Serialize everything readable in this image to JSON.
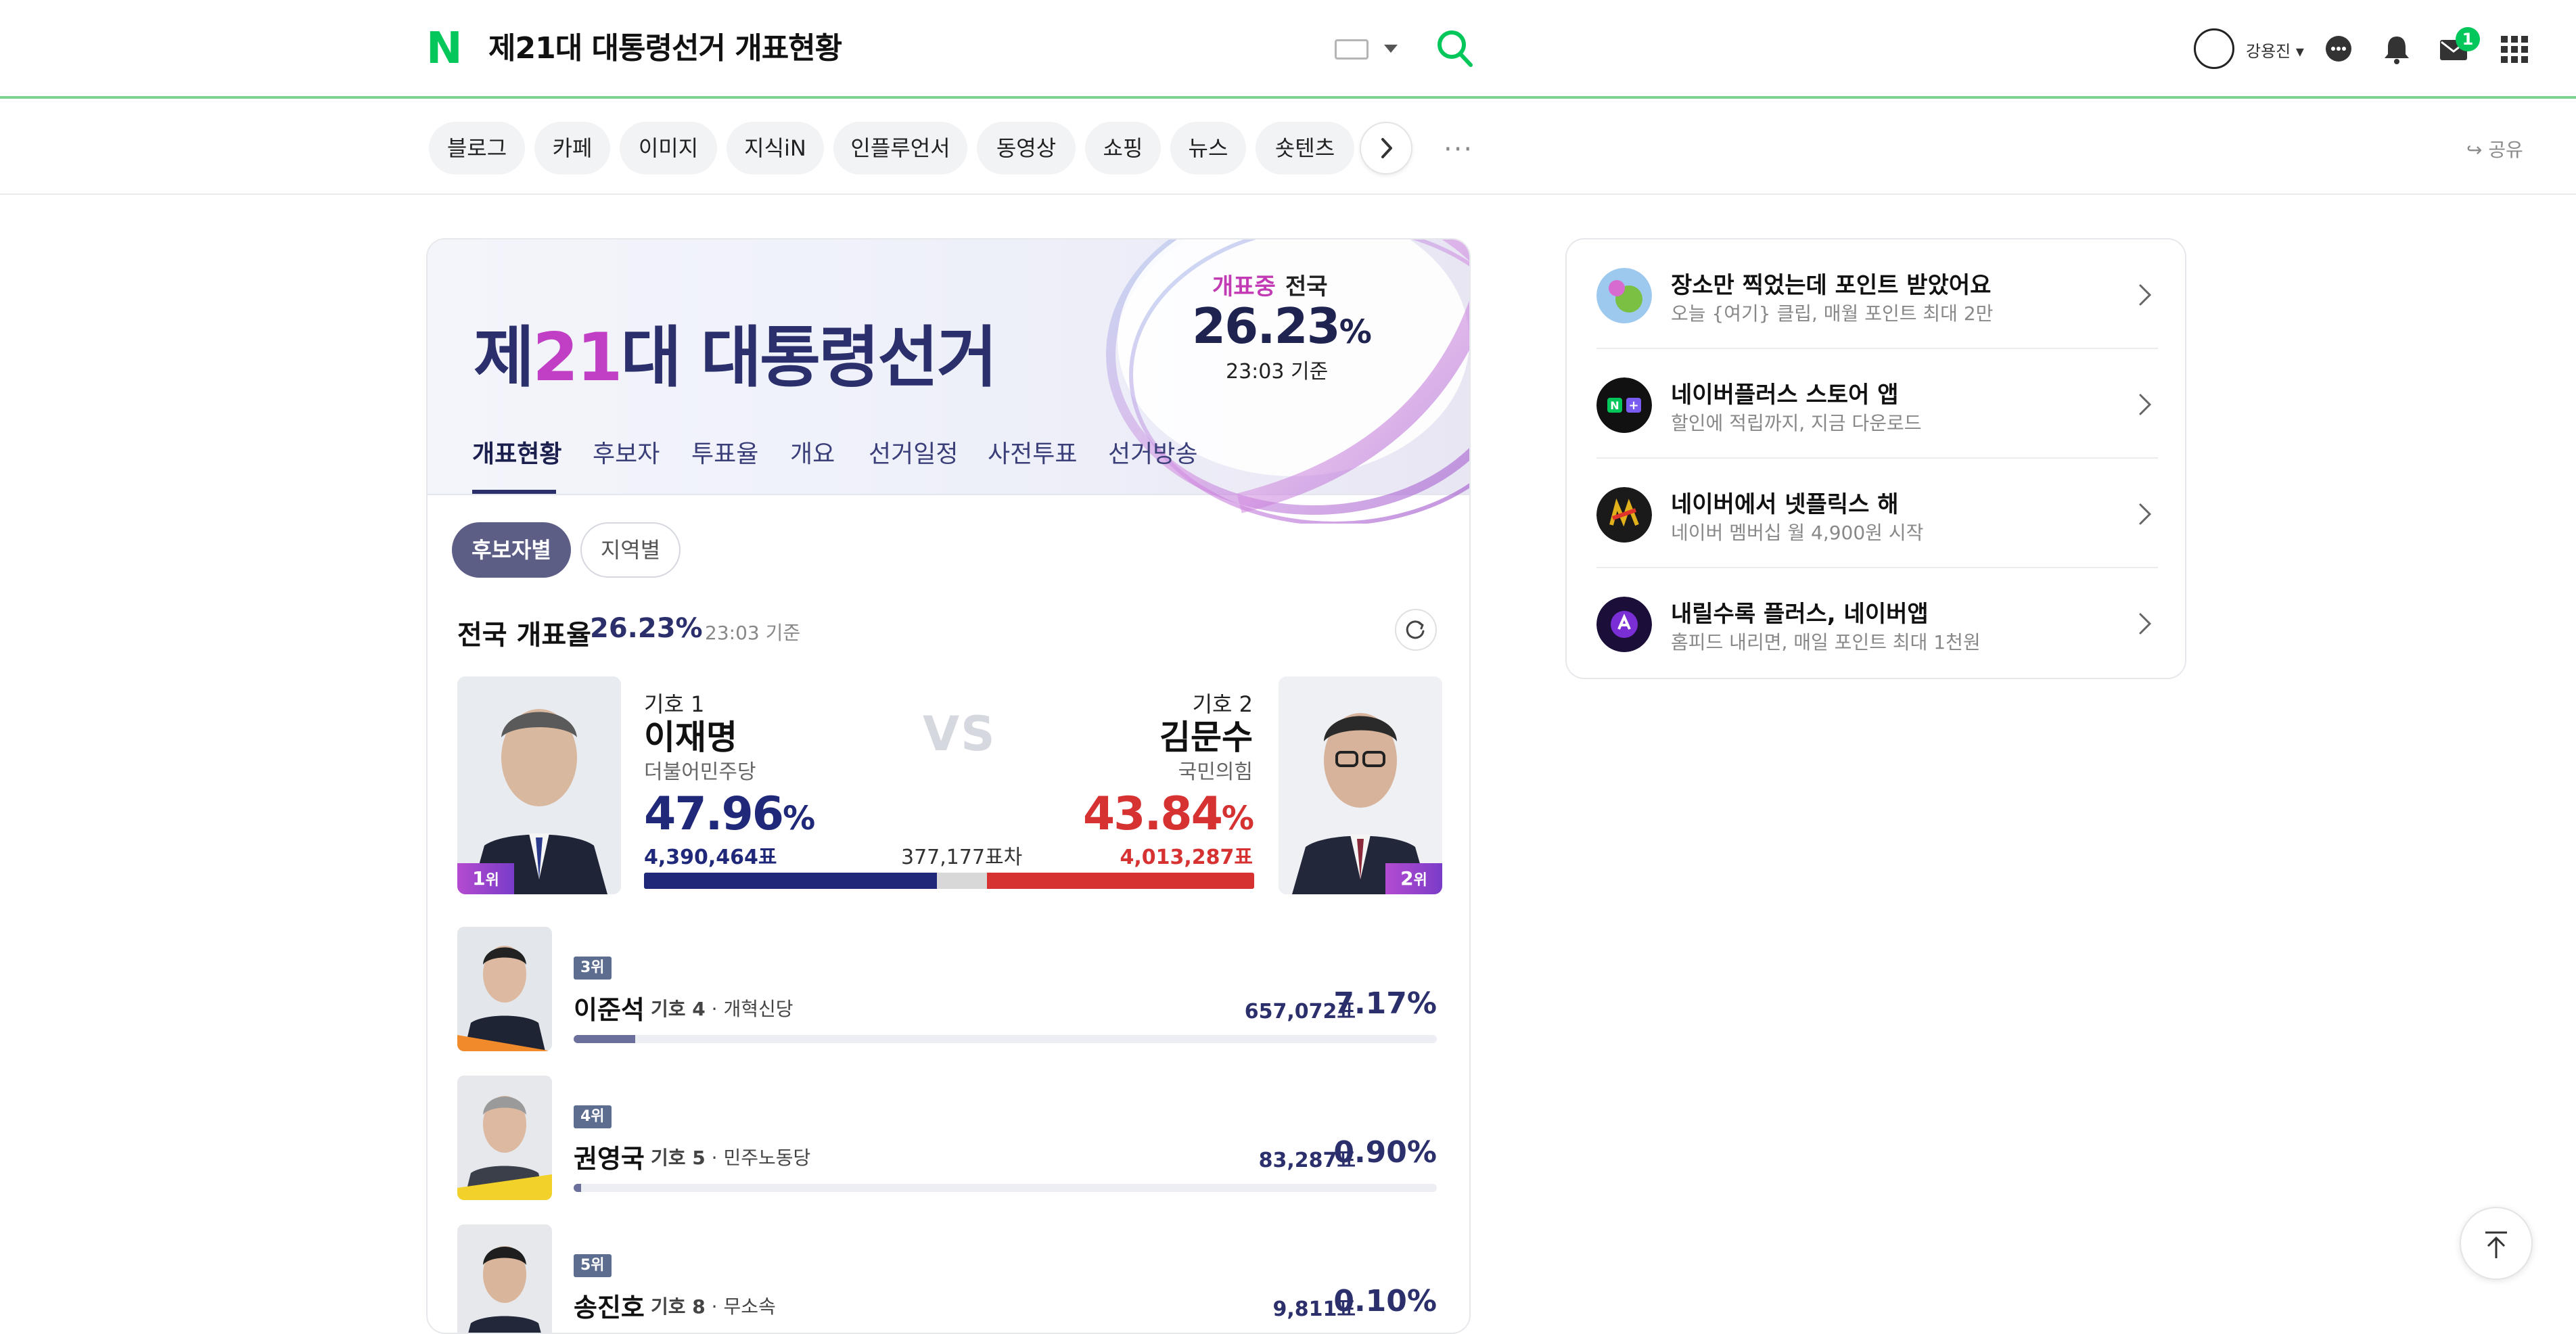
{
  "header": {
    "logo": "N",
    "query": "제21대 대통령선거 개표현황",
    "username": "강용진",
    "mail_badge": "1"
  },
  "tabs": {
    "items": [
      "블로그",
      "카페",
      "이미지",
      "지식iN",
      "인플루언서",
      "동영상",
      "쇼핑",
      "뉴스",
      "숏텐츠"
    ],
    "more": "···",
    "share": "공유"
  },
  "banner": {
    "title_prefix": "제",
    "title_number": "21",
    "title_suffix": "대 대통령선거",
    "status_live": "개표중",
    "status_region": "전국",
    "status_pct": "26.23",
    "status_pct_sign": "%",
    "status_time": "23:03 기준",
    "subtabs": [
      "개표현황",
      "후보자",
      "투표율",
      "개요",
      "선거일정",
      "사전투표",
      "선거방송"
    ]
  },
  "filters": {
    "candidate": "후보자별",
    "region": "지역별"
  },
  "national": {
    "label": "전국 개표율",
    "pct": "26.23%",
    "time": "23:03 기준"
  },
  "top_candidates": [
    {
      "rank": "1",
      "rank_suffix": "위",
      "number": "기호 1",
      "name": "이재명",
      "party": "더불어민주당",
      "pct": "47.96",
      "pct_sign": "%",
      "votes": "4,390,464표",
      "color": "#20287a"
    },
    {
      "rank": "2",
      "rank_suffix": "위",
      "number": "기호 2",
      "name": "김문수",
      "party": "국민의힘",
      "pct": "43.84",
      "pct_sign": "%",
      "votes": "4,013,287표",
      "color": "#d63232"
    }
  ],
  "vs": "VS",
  "diff": "377,177표차",
  "vote_share": {
    "a": 47.96,
    "b": 43.84
  },
  "other_candidates": [
    {
      "rank": "3위",
      "name": "이준석",
      "number": "기호 4",
      "party": "· 개혁신당",
      "votes": "657,072표",
      "pct": "7.17%",
      "share": 7.17
    },
    {
      "rank": "4위",
      "name": "권영국",
      "number": "기호 5",
      "party": "· 민주노동당",
      "votes": "83,287표",
      "pct": "0.90%",
      "share": 0.9
    },
    {
      "rank": "5위",
      "name": "송진호",
      "number": "기호 8",
      "party": "· 무소속",
      "votes": "9,811표",
      "pct": "0.10%",
      "share": 0.1
    }
  ],
  "ads": [
    {
      "title": "장소만 찍었는데 포인트 받았어요",
      "sub": "오늘 {여기} 클립, 매월 포인트 최대 2만",
      "icon": "clip-icon"
    },
    {
      "title": "네이버플러스 스토어 앱",
      "sub": "할인에 적립까지, 지금 다운로드",
      "icon": "naver-plus-store-icon"
    },
    {
      "title": "네이버에서 넷플릭스 해",
      "sub": "네이버 멤버십 월 4,900원 시작",
      "icon": "netflix-icon"
    },
    {
      "title": "내릴수록 플러스, 네이버앱",
      "sub": "홈피드 내리면, 매일 포인트 최대 1천원",
      "icon": "homefeed-icon"
    }
  ],
  "colors": {
    "naver_green": "#03c75a",
    "navy": "#2b2f6b",
    "red": "#d63232"
  }
}
